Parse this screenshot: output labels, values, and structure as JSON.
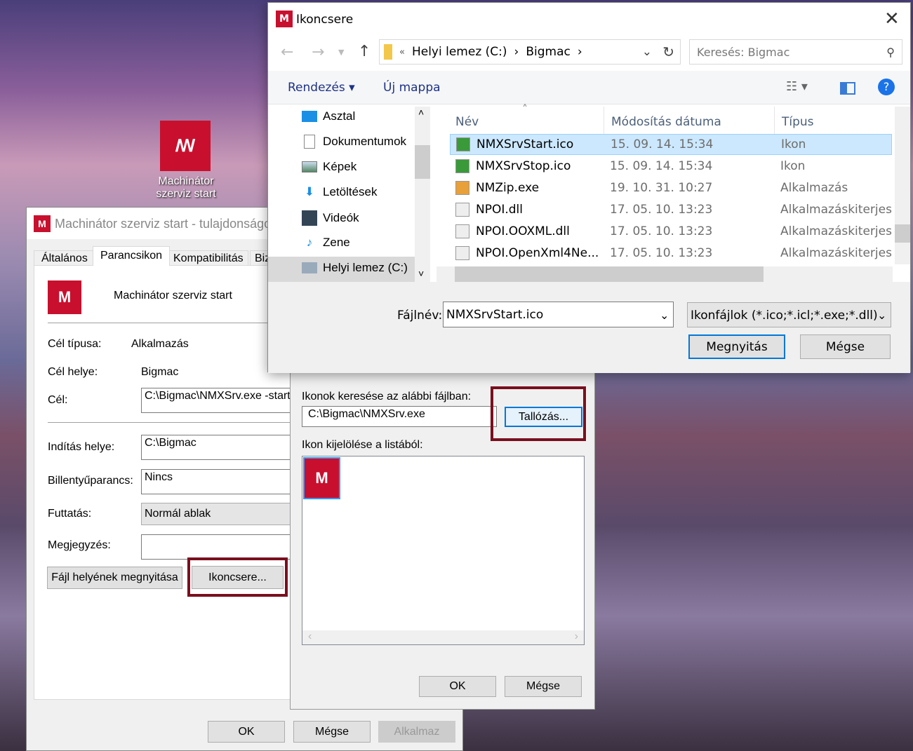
{
  "desktop": {
    "icon_label": "Machinátor szerviz start"
  },
  "props": {
    "title": "Machinátor szerviz start - tulajdonságok",
    "tabs": [
      "Általános",
      "Parancsikon",
      "Kompatibilitás",
      "Biz"
    ],
    "name": "Machinátor szerviz start",
    "fields": {
      "target_type_label": "Cél típusa:",
      "target_type": "Alkalmazás",
      "target_loc_label": "Cél helye:",
      "target_loc": "Bigmac",
      "target_label": "Cél:",
      "target": "C:\\Bigmac\\NMXSrv.exe -start",
      "start_label": "Indítás helye:",
      "start": "C:\\Bigmac",
      "hotkey_label": "Billentyűparancs:",
      "hotkey": "Nincs",
      "run_label": "Futtatás:",
      "run": "Normál ablak",
      "comment_label": "Megjegyzés:",
      "comment": ""
    },
    "open_location": "Fájl helyének megnyitása",
    "change_icon": "Ikoncsere...",
    "ok": "OK",
    "cancel": "Mégse",
    "apply": "Alkalmaz"
  },
  "change_icon": {
    "search_label": "Ikonok keresése az alábbi fájlban:",
    "path": "C:\\Bigmac\\NMXSrv.exe",
    "browse": "Tallózás...",
    "list_label": "Ikon kijelölése a listából:",
    "ok": "OK",
    "cancel": "Mégse"
  },
  "file_dialog": {
    "title": "Ikoncsere",
    "breadcrumb": [
      "«",
      "Helyi lemez (C:)",
      "Bigmac"
    ],
    "search_placeholder": "Keresés: Bigmac",
    "organize": "Rendezés",
    "new_folder": "Új mappa",
    "nav": [
      "Asztal",
      "Dokumentumok",
      "Képek",
      "Letöltések",
      "Videók",
      "Zene",
      "Helyi lemez (C:)"
    ],
    "columns": [
      "Név",
      "Módosítás dátuma",
      "Típus"
    ],
    "files": [
      {
        "name": "NMXSrvStart.ico",
        "date": "15. 09. 14. 15:34",
        "type": "Ikon"
      },
      {
        "name": "NMXSrvStop.ico",
        "date": "15. 09. 14. 15:34",
        "type": "Ikon"
      },
      {
        "name": "NMZip.exe",
        "date": "19. 10. 31. 10:27",
        "type": "Alkalmazás"
      },
      {
        "name": "NPOI.dll",
        "date": "17. 05. 10. 13:23",
        "type": "Alkalmazáskiterjesztés"
      },
      {
        "name": "NPOI.OOXML.dll",
        "date": "17. 05. 10. 13:23",
        "type": "Alkalmazáskiterjesztés"
      },
      {
        "name": "NPOI.OpenXml4Ne...",
        "date": "17. 05. 10. 13:23",
        "type": "Alkalmazáskiterjesztés"
      }
    ],
    "filename_label": "Fájlnév:",
    "filename": "NMXSrvStart.ico",
    "filter": "Ikonfájlok (*.ico;*.icl;*.exe;*.dll)",
    "open": "Megnyitás",
    "cancel": "Mégse"
  }
}
